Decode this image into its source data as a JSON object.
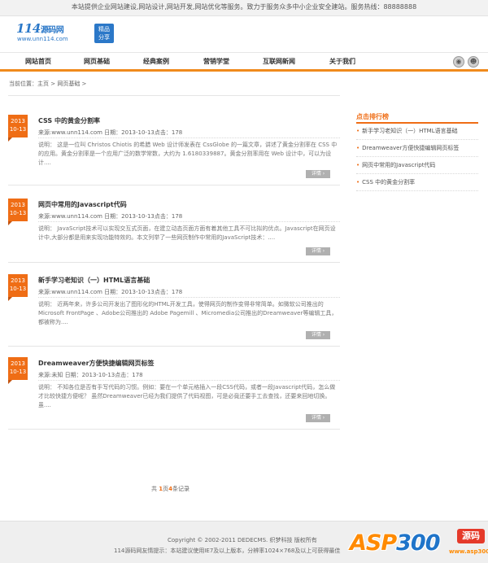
{
  "topbar": {
    "text": "本站提供企业网站建设,网站设计,网站开发,网站优化等服务。致力于服务众多中小企业安全建站。服务热线：88888888"
  },
  "logo": {
    "digits": "114",
    "name": "源码网",
    "url": "www.unn114.com",
    "badge_line1": "精品",
    "badge_line2": "分享"
  },
  "nav": {
    "items": [
      "网站首页",
      "网页基础",
      "经典案例",
      "营销学堂",
      "互联网新闻",
      "关于我们"
    ]
  },
  "breadcrumb": {
    "text": "当前位置：主页 > 网页基础 >"
  },
  "articles": [
    {
      "year": "2013",
      "date": "10-13",
      "title": "CSS 中的黄金分割率",
      "meta": "来源:www.unn114.com  日期：2013-10-13点击：178",
      "desc": "说明： 这是一位叫 Christos Chiotis 的希腊 Web 设计师发表在 CssGlobe 的一篇文章，讲述了黄金分割率在 CSS 中的应用。黄金分割率是一个应用广泛的数学常数，大约为 1.6180339887。黄金分割率用在 Web 设计中，可以为设计....",
      "btn": "详情"
    },
    {
      "year": "2013",
      "date": "10-13",
      "title": "网页中常用的Javascript代码",
      "meta": "来源:www.unn114.com  日期：2013-10-13点击：178",
      "desc": "说明： JavaScript技术可以实现交互式页面，在建立动态页面方面有着其他工具不可比拟的优点。Javascript在网页设计中,大部分都是用来实现功能特效的。本文列举了一些网页制作中常用的JavaScript技术：....",
      "btn": "详情"
    },
    {
      "year": "2013",
      "date": "10-13",
      "title": "新手学习老知识（一）HTML语言基础",
      "meta": "来源:www.unn114.com  日期：2013-10-13点击：178",
      "desc": "说明： 近两年来，许多公司开发出了图形化的HTML开发工具，使得网页的制作变得非常简单。如微软公司推出的 Microsoft FrontPage 、Adobe公司推出的 Adobe Pagemill 、Micromedia公司推出的Dreamweaver等编辑工具，都被称为....",
      "btn": "详情"
    },
    {
      "year": "2013",
      "date": "10-13",
      "title": "Dreamweaver方便快捷编辑网页标签",
      "meta": "来源:未知  日期：2013-10-13点击：178",
      "desc": "说明： 不知各位是否有手写代码的习惯。例如：要在一个单元格插入一段CSS代码，或者一段Javascript代码，怎么做才比较快捷方便呢？ 虽然Dreamweaver已经为我们提供了代码视图，可是必竟还要手工去查找，还要来回地切换。虽....",
      "btn": "详情"
    }
  ],
  "sidebar": {
    "title": "点击排行榜",
    "items": [
      "新手学习老知识（一）HTML语言基础",
      "Dreamweaver方便快捷编辑网页标签",
      "网页中常用的Javascript代码",
      "CSS 中的黄金分割率"
    ]
  },
  "pager": {
    "prefix": "共",
    "pages": "1",
    "mid": "页",
    "count": "4",
    "suffix": "条记录"
  },
  "footer": {
    "copyright": "Copyright © 2002-2011 DEDECMS. 织梦科技 版权所有",
    "tip": "114源码网友情提示：本站建议使用IE7及以上版本，分辨率1024×768及以上可获得最佳"
  },
  "watermark": {
    "asp": "ASP",
    "num": "300",
    "cn": "源码",
    "url": "www.asp300.com"
  },
  "colors": {
    "accent": "#ef6d15",
    "brand_blue": "#2b78c8"
  }
}
